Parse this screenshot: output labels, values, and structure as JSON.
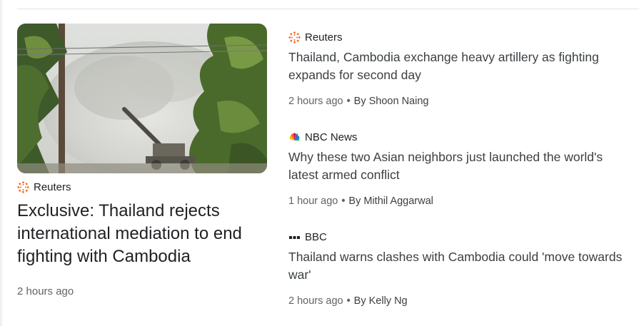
{
  "featured": {
    "source": {
      "name": "Reuters",
      "icon": "reuters-logo-icon"
    },
    "headline": "Exclusive: Thailand rejects international mediation to end fighting with Cambodia",
    "time": "2 hours ago",
    "image": {
      "subject": "artillery-smoke-photo"
    }
  },
  "stories": [
    {
      "source": {
        "name": "Reuters",
        "icon": "reuters-logo-icon"
      },
      "headline": "Thailand, Cambodia exchange heavy artillery as fighting expands for second day",
      "time": "2 hours ago",
      "author": "By Shoon Naing"
    },
    {
      "source": {
        "name": "NBC News",
        "icon": "nbc-peacock-icon"
      },
      "headline": "Why these two Asian neighbors just launched the world's latest armed conflict",
      "time": "1 hour ago",
      "author": "By Mithil Aggarwal"
    },
    {
      "source": {
        "name": "BBC",
        "icon": "bbc-blocks-icon"
      },
      "headline": "Thailand warns clashes with Cambodia could 'move towards war'",
      "time": "2 hours ago",
      "author": "By Kelly Ng"
    }
  ],
  "colors": {
    "reuters_orange": "#f26b2b",
    "headline_text": "#202124",
    "meta_text": "#5f6368"
  }
}
